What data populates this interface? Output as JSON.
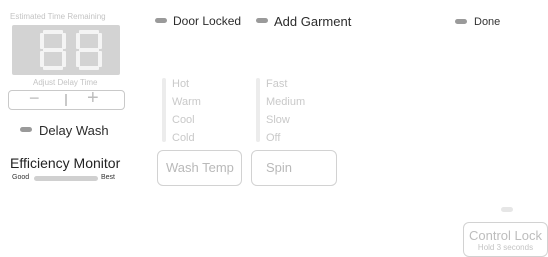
{
  "display": {
    "top_label": "Estimated Time Remaining",
    "bottom_label": "Adjust Delay Time"
  },
  "delay_stepper": {
    "minus": "−",
    "plus": "+"
  },
  "delay_wash": {
    "label": "Delay Wash"
  },
  "efficiency": {
    "title": "Efficiency Monitor",
    "left": "Good",
    "right": "Best"
  },
  "status": {
    "door_locked": "Door Locked",
    "add_garment": "Add Garment",
    "done": "Done"
  },
  "wash_temp": {
    "options": [
      "Hot",
      "Warm",
      "Cool",
      "Cold"
    ],
    "button_label": "Wash Temp"
  },
  "spin": {
    "options": [
      "Fast",
      "Medium",
      "Slow",
      "Off"
    ],
    "button_label": "Spin"
  },
  "control_lock": {
    "label": "Control Lock",
    "sublabel": "Hold 3 seconds"
  },
  "colors": {
    "led_on": "#9a9a9a",
    "led_off": "#e6e6e6",
    "display_bg": "#d3d3d3"
  }
}
